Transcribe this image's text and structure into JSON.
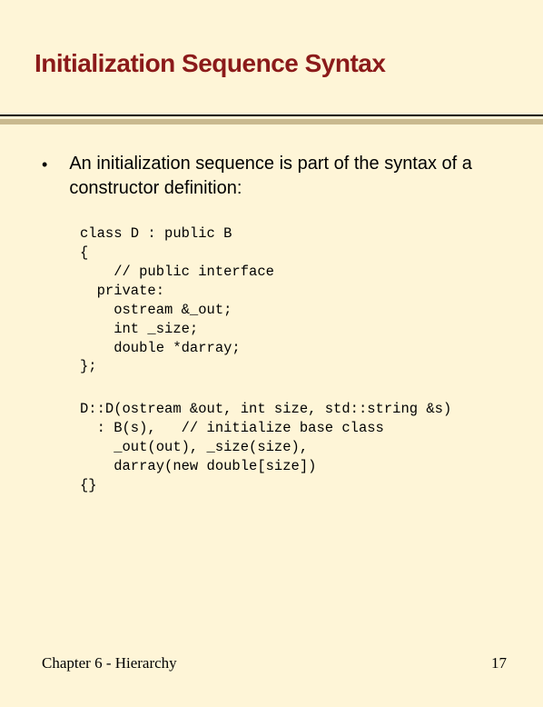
{
  "title": "Initialization Sequence Syntax",
  "bullet_text": "An initialization sequence is part of the syntax of a constructor definition:",
  "code1": "class D : public B\n{\n    // public interface\n  private:\n    ostream &_out;\n    int _size;\n    double *darray;\n};",
  "code2": "D::D(ostream &out, int size, std::string &s)\n  : B(s),   // initialize base class\n    _out(out), _size(size),\n    darray(new double[size])\n{}",
  "footer_left": "Chapter 6 - Hierarchy",
  "footer_right": "17"
}
